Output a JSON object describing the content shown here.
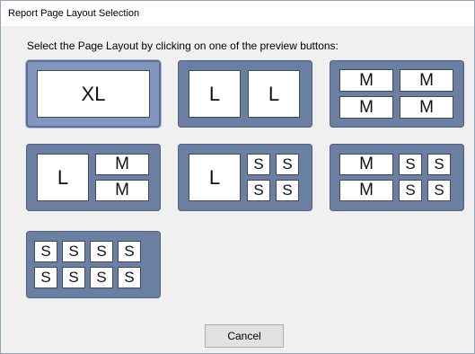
{
  "window": {
    "title": "Report Page Layout Selection"
  },
  "instruction": "Select the Page Layout by clicking on one of the preview buttons:",
  "layouts": {
    "xl": {
      "cells": [
        "XL"
      ]
    },
    "l_l": {
      "cells": [
        "L",
        "L"
      ]
    },
    "m4": {
      "cells": [
        "M",
        "M",
        "M",
        "M"
      ]
    },
    "l_m2": {
      "cells": [
        "L",
        "M",
        "M"
      ]
    },
    "l_s4": {
      "cells": [
        "L",
        "S",
        "S",
        "S",
        "S"
      ]
    },
    "m2_s4": {
      "cells": [
        "M",
        "M",
        "S",
        "S",
        "S",
        "S"
      ]
    },
    "s8": {
      "cells": [
        "S",
        "S",
        "S",
        "S",
        "S",
        "S",
        "S",
        "S"
      ]
    }
  },
  "buttons": {
    "cancel": "Cancel"
  },
  "colors": {
    "tile": "#6b7fa3",
    "tile_selected": "#8096be",
    "dialog_bg": "#f0f0f0"
  }
}
